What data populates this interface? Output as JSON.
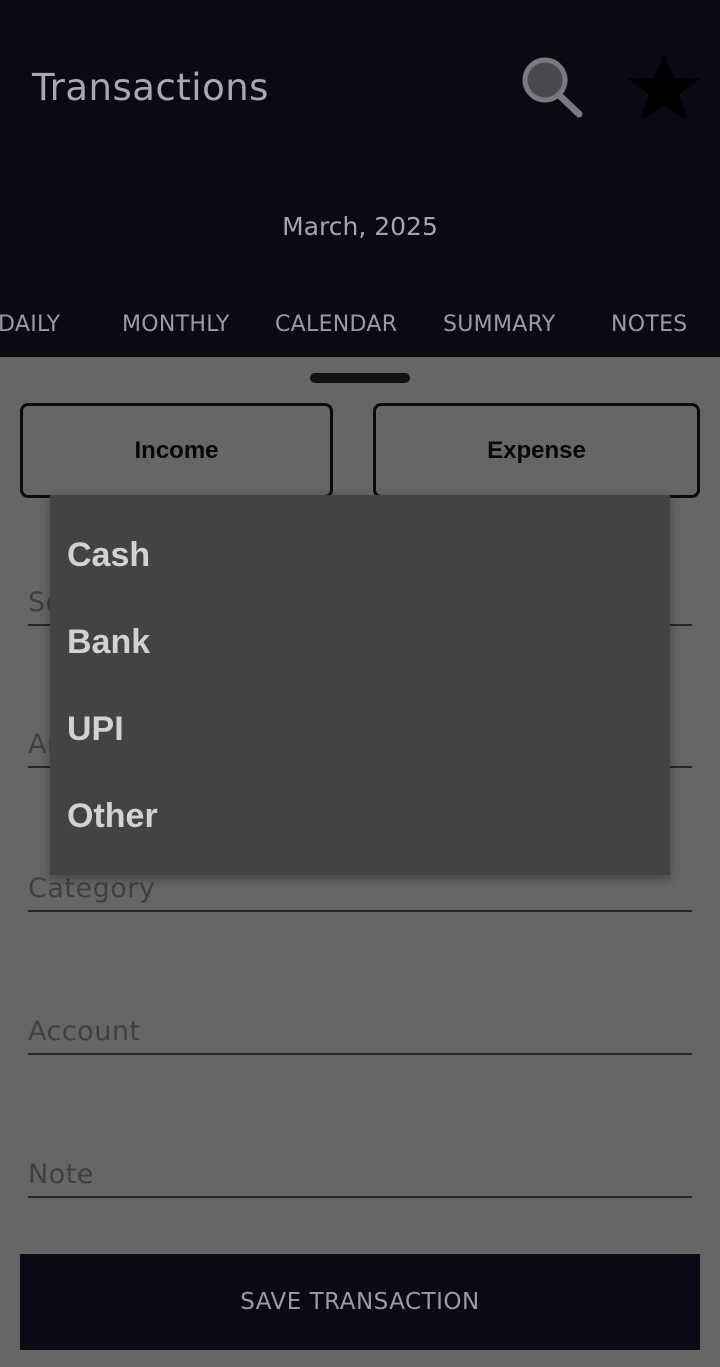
{
  "header": {
    "title": "Transactions",
    "search_icon": "search-icon",
    "star_icon": "star-icon",
    "month_label": "March, 2025"
  },
  "tabs": [
    {
      "label": "DAILY"
    },
    {
      "label": "MONTHLY"
    },
    {
      "label": "CALENDAR"
    },
    {
      "label": "SUMMARY"
    },
    {
      "label": "NOTES"
    }
  ],
  "form": {
    "income_label": "Income",
    "expense_label": "Expense",
    "fields": {
      "source_placeholder": "Source",
      "amount_placeholder": "Amount",
      "category_placeholder": "Category",
      "account_placeholder": "Account",
      "note_placeholder": "Note"
    },
    "save_label": "SAVE TRANSACTION"
  },
  "dropdown": {
    "options": [
      "Cash",
      "Bank",
      "UPI",
      "Other"
    ]
  },
  "colors": {
    "header_bg": "#090a13",
    "scrim_bg": "#666666",
    "dropdown_bg": "#434343"
  }
}
